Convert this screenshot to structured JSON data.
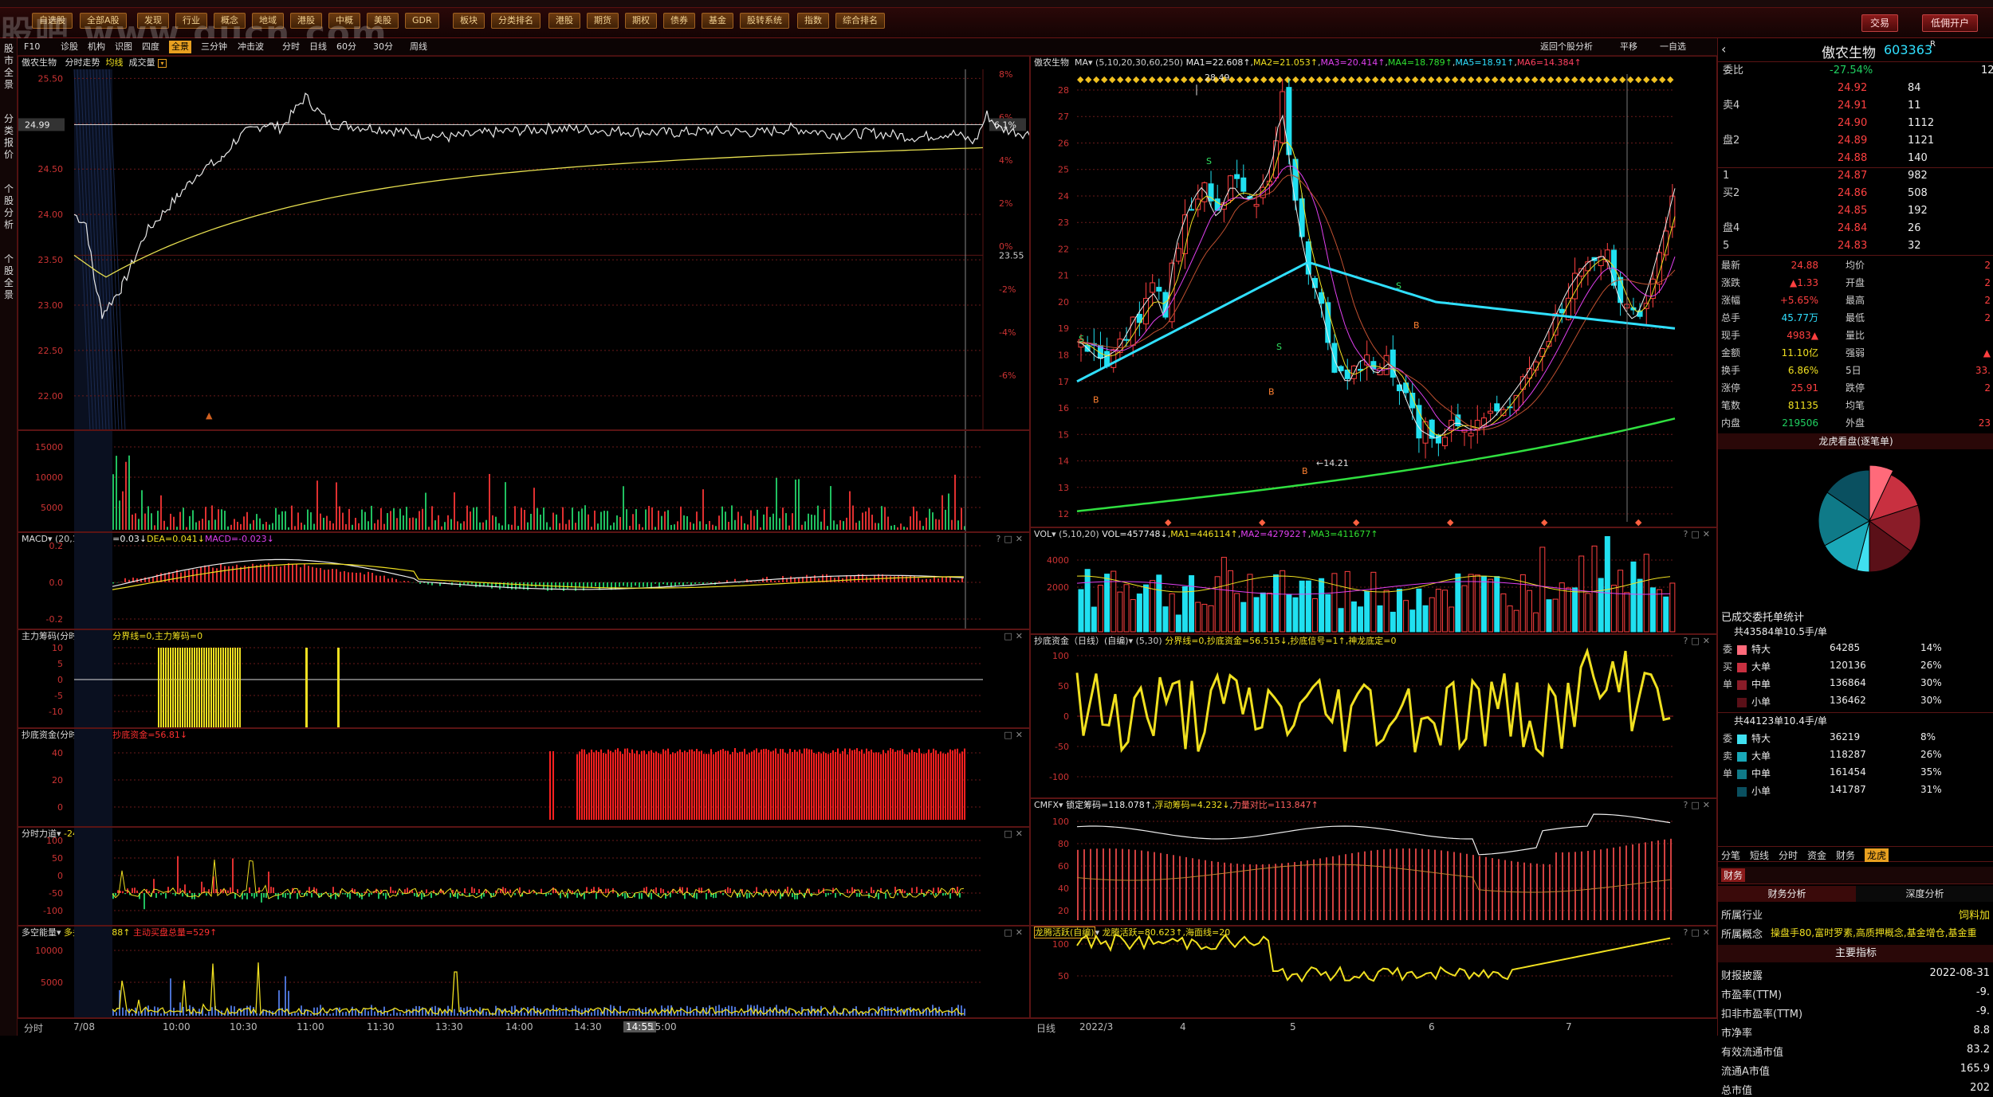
{
  "toolbar": {
    "buttons": [
      "自选股",
      "全部A股",
      "发现",
      "行业",
      "概念",
      "地域",
      "港股",
      "中概",
      "美股",
      "GDR",
      "板块",
      "分类排名",
      "港股",
      "期货",
      "期权",
      "债券",
      "基金",
      "股转系统",
      "指数",
      "综合排名"
    ],
    "right_buttons": [
      "交易",
      "低佣开户"
    ],
    "watermark": "股吧 www.gucn.com"
  },
  "left_nav": [
    "股市全景",
    "分类报价",
    "个股分析",
    "个股全景"
  ],
  "intraday_bar": {
    "items": [
      "F10",
      "诊股",
      "机构",
      "识图",
      "四度",
      "全景",
      "三分钟",
      "冲击波",
      "分时",
      "日线",
      "60分",
      "30分",
      "周线"
    ],
    "active": "全景"
  },
  "daily_bar": {
    "items": [
      "返回个股分析",
      "平移",
      "一自选"
    ]
  },
  "intraday": {
    "header": {
      "stock": "傲农生物",
      "label": "分时走势",
      "avg": "均线",
      "vol": "成交量"
    },
    "price_ticks": [
      "25.50",
      "25.00",
      "24.50",
      "24.00",
      "23.50",
      "23.00",
      "22.50",
      "22.00"
    ],
    "pct_ticks": [
      "8%",
      "6%",
      "4%",
      "2%",
      "0%",
      "-2%",
      "-4%",
      "-6%"
    ],
    "current_price": "24.99",
    "current_pct": "6.1%",
    "prev_close": "23.55",
    "vol_ticks": [
      "15000",
      "10000",
      "5000"
    ],
    "macd": {
      "title": "MACD",
      "params": "(20,10,7)",
      "dif": "DIF=0.03↓",
      "dea": "DEA=0.041↓",
      "macd": "MACD=-0.023↓",
      "ticks": [
        "0.2",
        "0.0",
        "-0.2"
      ]
    },
    "zlcm": {
      "title": "主力筹码(分时)(自编)",
      "line": "分界线=0,主力筹码=0",
      "ticks": [
        "10",
        "5",
        "0",
        "-5",
        "-10"
      ]
    },
    "cdzj": {
      "title": "抄底资金(分时)(自编)",
      "line": "抄底资金=56.81↓",
      "ticks": [
        "40",
        "20",
        "0"
      ]
    },
    "fsld": {
      "title": "分时力道",
      "line": "-24.203↓",
      "ticks": [
        "100",
        "50",
        "0",
        "-50",
        "-100"
      ]
    },
    "dkn": {
      "title": "多空能量",
      "line1": "多头量能=188↑",
      "line2": "主动买盘总量=529↑",
      "ticks": [
        "10000",
        "5000"
      ]
    },
    "time_labels": [
      "分时",
      "7/08",
      "10:00",
      "10:30",
      "11:00",
      "11:30",
      "13:30",
      "14:00",
      "14:30",
      "14:55",
      "15:00"
    ]
  },
  "daily": {
    "header": {
      "stock": "傲农生物",
      "ma": "MA",
      "params": "(5,10,20,30,60,250)",
      "ma1": "MA1=22.608↑",
      "ma2": "MA2=21.053↑",
      "ma3": "MA3=20.414↑",
      "ma4": "MA4=18.789↑",
      "ma5": "MA5=18.91↑",
      "ma6": "MA6=14.384↑"
    },
    "price_ticks": [
      "28",
      "27",
      "26",
      "25",
      "24",
      "23",
      "22",
      "21",
      "20",
      "19",
      "18",
      "17",
      "16",
      "15",
      "14",
      "13",
      "12"
    ],
    "high_label": "28.49",
    "low_label": "14.21",
    "vol": {
      "title": "VOL",
      "params": "(5,10,20)",
      "vol": "VOL=457748↓",
      "ma1": "MA1=446114↑",
      "ma2": "MA2=427922↑",
      "ma3": "MA3=411677↑",
      "ticks": [
        "4000",
        "2000"
      ]
    },
    "cdzj": {
      "title": "抄底资金（日线）(自编)",
      "params": "(5,30)",
      "line": "分界线=0,抄底资金=56.515↓,抄底信号=1↑,神龙底定=0",
      "ticks": [
        "100",
        "50",
        "0",
        "-50",
        "-100"
      ]
    },
    "cmfx": {
      "title": "CMFX",
      "line1": "锁定筹码=118.078↑",
      "line2": "浮动筹码=4.232↓",
      "line3": "力量对比=113.847↑",
      "ticks": [
        "100",
        "80",
        "60",
        "40",
        "20"
      ]
    },
    "lthy": {
      "title": "龙腾活跃(自编)",
      "line": "龙腾活跃=80.623↑,海面线=20",
      "ticks": [
        "100",
        "50"
      ]
    },
    "date_labels": [
      "日线",
      "2022/3",
      "4",
      "5",
      "6",
      "7"
    ]
  },
  "quote": {
    "name": "傲农生物",
    "code": "603363",
    "mark": "R",
    "weibi": {
      "label": "委比",
      "value": "-27.54%",
      "right": "12"
    },
    "asks": [
      {
        "label": "",
        "price": "24.92",
        "vol": "84"
      },
      {
        "label": "卖4",
        "price": "24.91",
        "vol": "11"
      },
      {
        "label": "",
        "price": "24.90",
        "vol": "1112"
      },
      {
        "label": "盘2",
        "price": "24.89",
        "vol": "1121"
      },
      {
        "label": "",
        "price": "24.88",
        "vol": "140"
      }
    ],
    "bids": [
      {
        "label": "1",
        "price": "24.87",
        "vol": "982"
      },
      {
        "label": "买2",
        "price": "24.86",
        "vol": "508"
      },
      {
        "label": "",
        "price": "24.85",
        "vol": "192"
      },
      {
        "label": "盘4",
        "price": "24.84",
        "vol": "26"
      },
      {
        "label": "5",
        "price": "24.83",
        "vol": "32"
      }
    ],
    "stats": [
      {
        "l": "最新",
        "v": "24.88",
        "l2": "均价",
        "v2": "2"
      },
      {
        "l": "涨跌",
        "v": "▲1.33",
        "l2": "开盘",
        "v2": "2"
      },
      {
        "l": "涨幅",
        "v": "+5.65%",
        "l2": "最高",
        "v2": "2"
      },
      {
        "l": "总手",
        "v": "45.77万",
        "l2": "最低",
        "v2": "2"
      },
      {
        "l": "现手",
        "v": "4983▲",
        "l2": "量比",
        "v2": ""
      },
      {
        "l": "金额",
        "v": "11.10亿",
        "l2": "强弱",
        "v2": "▲"
      },
      {
        "l": "换手",
        "v": "6.86%",
        "l2": "5日",
        "v2": "33."
      },
      {
        "l": "涨停",
        "v": "25.91",
        "l2": "跌停",
        "v2": "2"
      },
      {
        "l": "笔数",
        "v": "81135",
        "l2": "均笔",
        "v2": ""
      },
      {
        "l": "内盘",
        "v": "219506",
        "l2": "外盘",
        "v2": "23"
      }
    ],
    "pie_title": "龙虎看盘(逐笔单)",
    "pie_slices": [
      {
        "share": 0.14,
        "color": "#ff6a7a"
      },
      {
        "share": 0.26,
        "color": "#c83040"
      },
      {
        "share": 0.3,
        "color": "#8a1c28"
      },
      {
        "share": 0.3,
        "color": "#5a1018"
      },
      {
        "share": 0.08,
        "color": "#40e0f0"
      },
      {
        "share": 0.26,
        "color": "#1aa8b8"
      },
      {
        "share": 0.35,
        "color": "#0f7a88"
      },
      {
        "share": 0.31,
        "color": "#0a5060"
      }
    ],
    "deal_title": "已成交委托单统计",
    "buy_total": "共43584单10.5手/单",
    "buy_rows": [
      {
        "side": "委",
        "type": "特大",
        "vol": "64285",
        "pct": "14%",
        "color": "#ff6a7a"
      },
      {
        "side": "买",
        "type": "大单",
        "vol": "120136",
        "pct": "26%",
        "color": "#c83040"
      },
      {
        "side": "单",
        "type": "中单",
        "vol": "136864",
        "pct": "30%",
        "color": "#8a1c28"
      },
      {
        "side": "",
        "type": "小单",
        "vol": "136462",
        "pct": "30%",
        "color": "#5a1018"
      }
    ],
    "sell_total": "共44123单10.4手/单",
    "sell_rows": [
      {
        "side": "委",
        "type": "特大",
        "vol": "36219",
        "pct": "8%",
        "color": "#40e0f0"
      },
      {
        "side": "卖",
        "type": "大单",
        "vol": "118287",
        "pct": "26%",
        "color": "#1aa8b8"
      },
      {
        "side": "单",
        "type": "中单",
        "vol": "161454",
        "pct": "35%",
        "color": "#0f7a88"
      },
      {
        "side": "",
        "type": "小单",
        "vol": "141787",
        "pct": "31%",
        "color": "#0a5060"
      }
    ],
    "tabs": [
      "分笔",
      "短线",
      "分时",
      "资金",
      "财务",
      "龙虎"
    ],
    "active_tab": "龙虎",
    "fin_tab": "财务",
    "fin_subtabs": [
      "财务分析",
      "深度分析"
    ],
    "industry": {
      "label": "所属行业",
      "value": "饲料加"
    },
    "concept": {
      "label": "所属概念",
      "value": "操盘手80,富时罗素,高质押概念,基金增仓,基金重"
    },
    "main_title": "主要指标",
    "fin_rows": [
      {
        "l": "财报披露",
        "v": "2022-08-31"
      },
      {
        "l": "市盈率(TTM)",
        "v": "-9."
      },
      {
        "l": "扣非市盈率(TTM)",
        "v": "-9."
      },
      {
        "l": "市净率",
        "v": "8.8"
      },
      {
        "l": "有效流通市值",
        "v": "83.2"
      },
      {
        "l": "流通A市值",
        "v": "165.9"
      },
      {
        "l": "总市值",
        "v": "202"
      }
    ]
  }
}
